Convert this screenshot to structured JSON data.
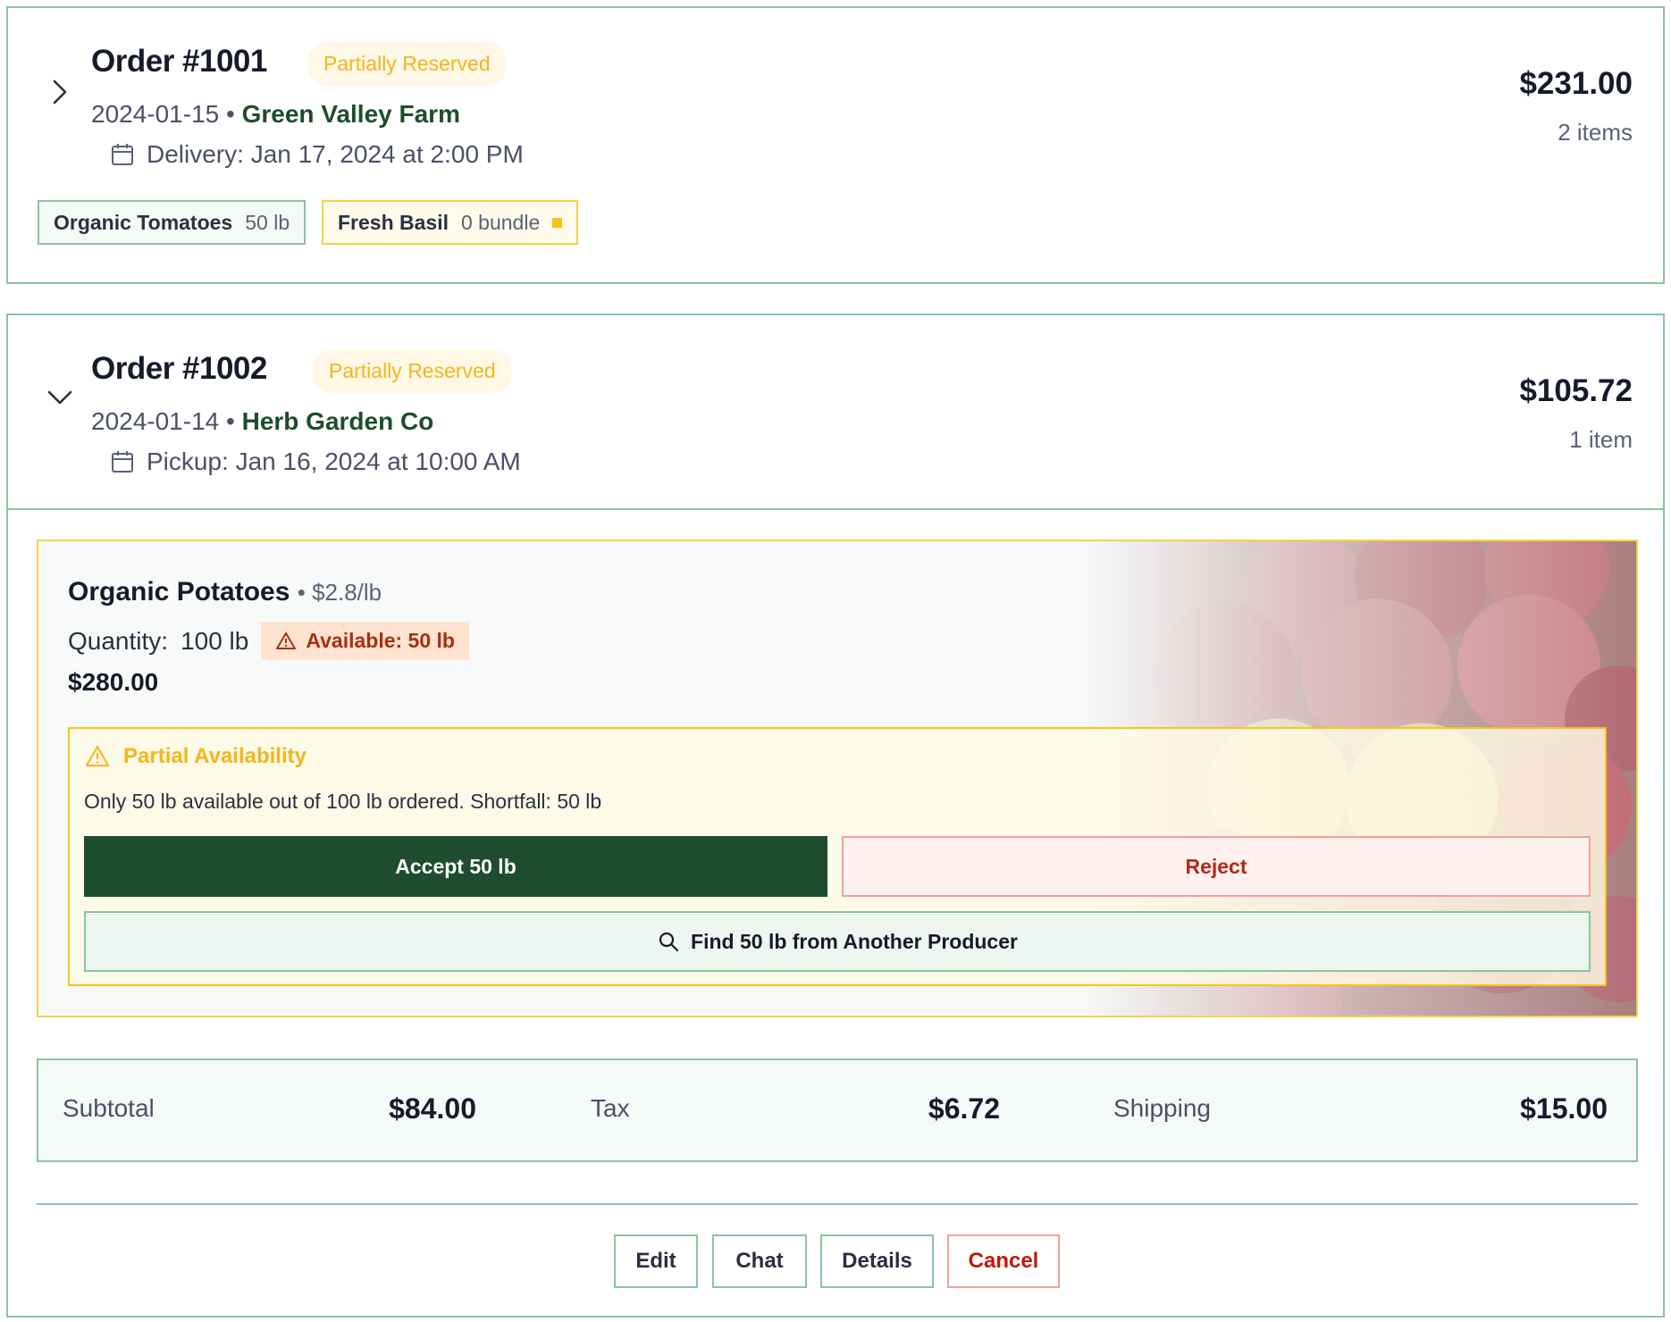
{
  "orders": [
    {
      "title": "Order #1001",
      "status": "Partially Reserved",
      "date": "2024-01-15",
      "separator": "•",
      "farm": "Green Valley Farm",
      "schedule": "Delivery: Jan 17, 2024 at 2:00 PM",
      "total": "$231.00",
      "item_count": "2 items",
      "expanded": false,
      "chips": [
        {
          "name": "Organic Tomatoes",
          "qty": "50 lb",
          "flag": false
        },
        {
          "name": "Fresh Basil",
          "qty": "0 bundle",
          "flag": true
        }
      ]
    },
    {
      "title": "Order #1002",
      "status": "Partially Reserved",
      "date": "2024-01-14",
      "separator": "•",
      "farm": "Herb Garden Co",
      "schedule": "Pickup: Jan 16, 2024 at 10:00 AM",
      "total": "$105.72",
      "item_count": "1 item",
      "expanded": true,
      "item": {
        "name": "Organic Potatoes",
        "unit_price": "• $2.8/lb",
        "quantity_label": "Quantity:",
        "quantity": "100 lb",
        "available": "Available: 50 lb",
        "line_total": "$280.00",
        "warning": {
          "title": "Partial Availability",
          "text": "Only 50 lb available out of 100 lb ordered. Shortfall: 50 lb",
          "accept_label": "Accept 50 lb",
          "reject_label": "Reject",
          "find_label": "Find 50 lb from Another Producer"
        }
      },
      "summary": {
        "subtotal_label": "Subtotal",
        "subtotal": "$84.00",
        "tax_label": "Tax",
        "tax": "$6.72",
        "shipping_label": "Shipping",
        "shipping": "$15.00"
      },
      "actions": {
        "edit": "Edit",
        "chat": "Chat",
        "details": "Details",
        "cancel": "Cancel"
      }
    }
  ],
  "colors": {
    "accent_green": "#1d4d2e",
    "border_green": "#8cc4a0",
    "status_yellow": "#f2b619",
    "danger_red": "#b02a18"
  },
  "icons": {
    "collapsed": "chevron-right-icon",
    "expanded": "chevron-down-icon",
    "date": "calendar-icon",
    "warning": "warning-triangle-icon",
    "search": "search-icon"
  }
}
